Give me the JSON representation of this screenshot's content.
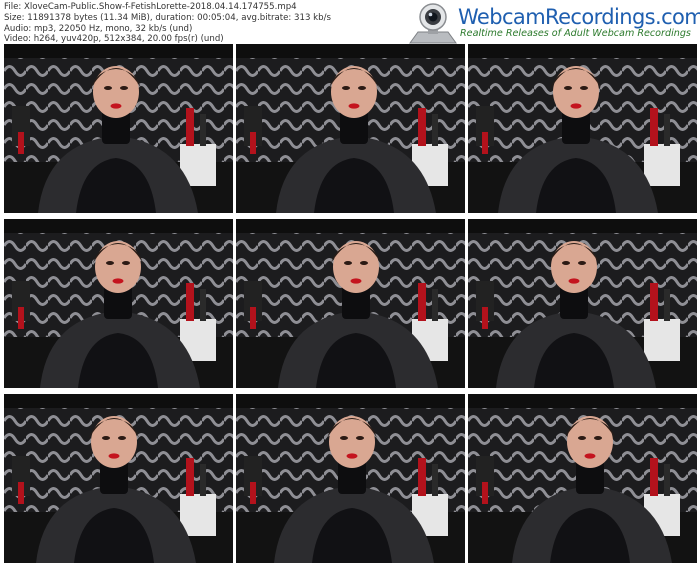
{
  "info": {
    "file": "File: XloveCam-Public.Show-f-FetishLorette-2018.04.14.174755.mp4",
    "size": "Size: 11891378 bytes (11.34 MiB), duration: 00:05:04, avg.bitrate: 313 kb/s",
    "audio": "Audio: mp3, 22050 Hz, mono, 32 kb/s (und)",
    "video": "Video: h264, yuv420p, 512x384, 20.00 fps(r) (und)"
  },
  "brand": {
    "name": "WebcamRecordings.com",
    "tagline": "Realtime Releases of Adult Webcam Recordings",
    "icon": "webcam-icon"
  },
  "colors": {
    "brand_blue": "#1f5fb0",
    "tagline_green": "#2c7a2c",
    "wall_dark": "#1c1c1e",
    "wall_pattern": "#8f8f95",
    "accent_red": "#b3121c"
  },
  "thumbnails": [
    {
      "id": 1
    },
    {
      "id": 2
    },
    {
      "id": 3
    },
    {
      "id": 4
    },
    {
      "id": 5
    },
    {
      "id": 6
    },
    {
      "id": 7
    },
    {
      "id": 8
    },
    {
      "id": 9
    }
  ]
}
